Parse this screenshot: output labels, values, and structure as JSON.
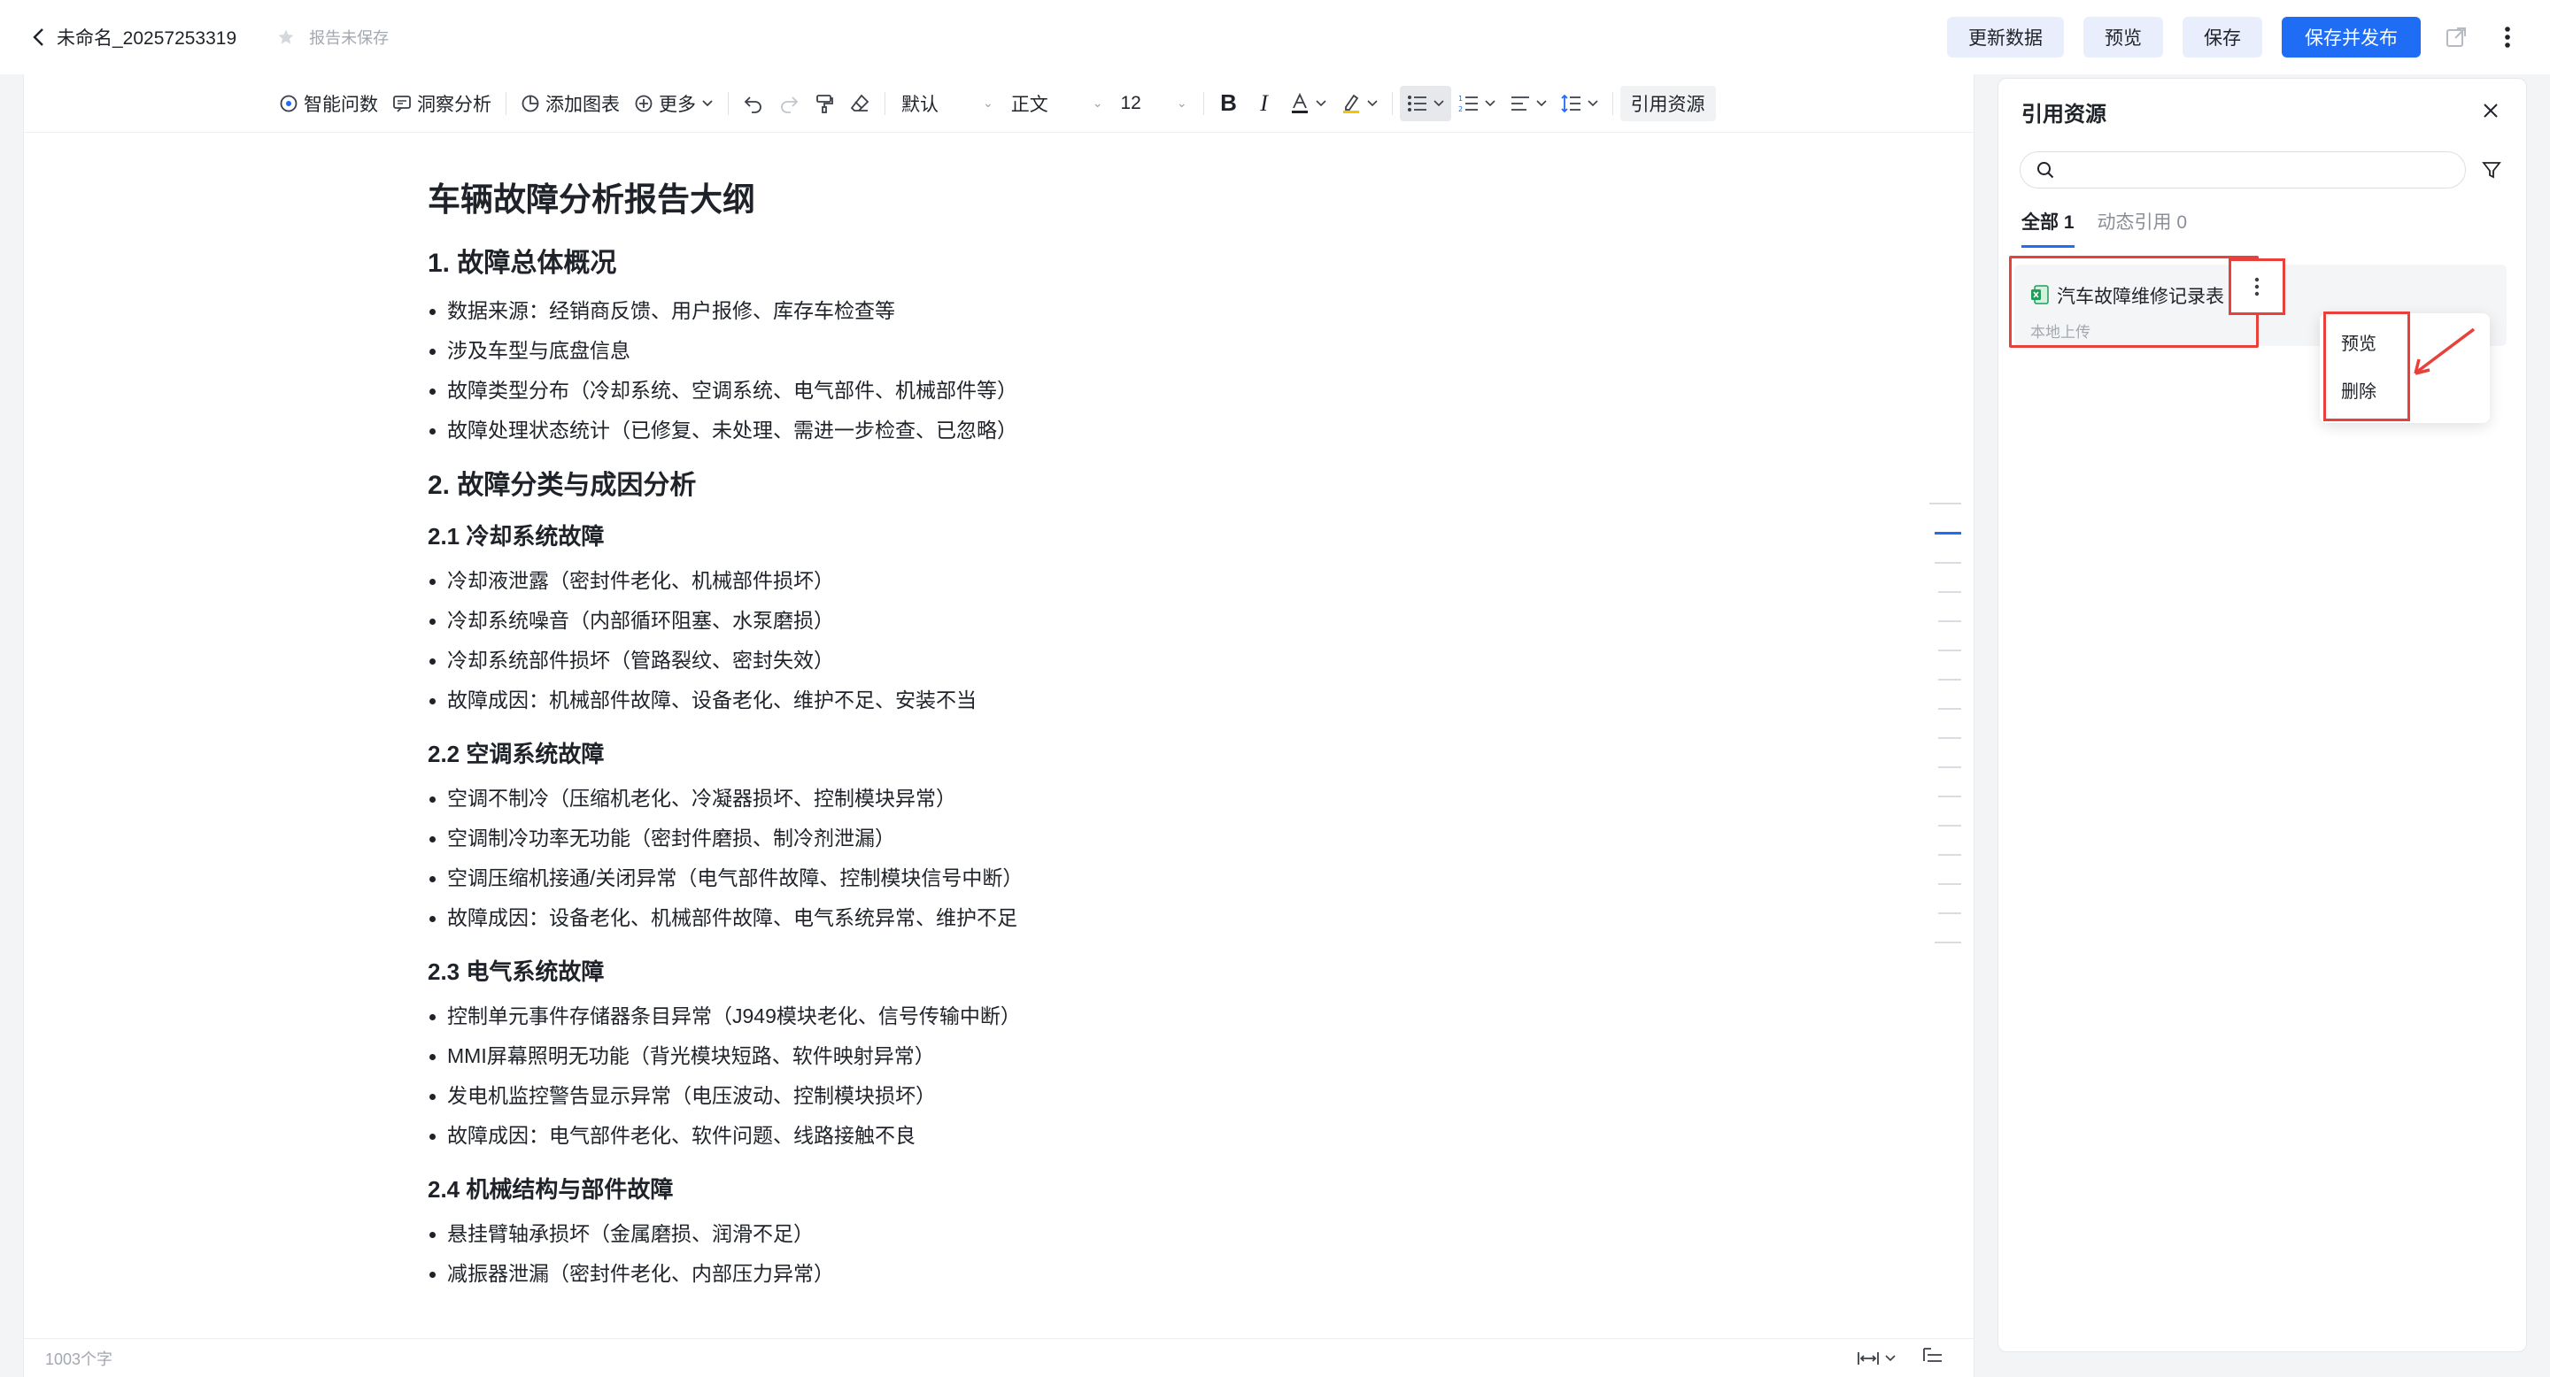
{
  "header": {
    "doc_title": "未命名_20257253319",
    "save_status": "报告未保存",
    "buttons": {
      "update": "更新数据",
      "preview": "预览",
      "save": "保存",
      "publish": "保存并发布"
    },
    "accent_color": "#1f6cf5"
  },
  "toolbar": {
    "ask": "智能问数",
    "insight": "洞察分析",
    "add_chart": "添加图表",
    "more": "更多",
    "font": "默认",
    "style": "正文",
    "size": "12",
    "cite": "引用资源"
  },
  "document": {
    "title": "车辆故障分析报告大纲",
    "s1": {
      "heading": "1. 故障总体概况",
      "items": [
        "数据来源：经销商反馈、用户报修、库存车检查等",
        "涉及车型与底盘信息",
        "故障类型分布（冷却系统、空调系统、电气部件、机械部件等）",
        "故障处理状态统计（已修复、未处理、需进一步检查、已忽略）"
      ]
    },
    "s2": {
      "heading": "2. 故障分类与成因分析"
    },
    "s21": {
      "heading": "2.1 冷却系统故障",
      "items": [
        "冷却液泄露（密封件老化、机械部件损坏）",
        "冷却系统噪音（内部循环阻塞、水泵磨损）",
        "冷却系统部件损坏（管路裂纹、密封失效）",
        "故障成因：机械部件故障、设备老化、维护不足、安装不当"
      ]
    },
    "s22": {
      "heading": "2.2 空调系统故障",
      "items": [
        "空调不制冷（压缩机老化、冷凝器损坏、控制模块异常）",
        "空调制冷功率无功能（密封件磨损、制冷剂泄漏）",
        "空调压缩机接通/关闭异常（电气部件故障、控制模块信号中断）",
        "故障成因：设备老化、机械部件故障、电气系统异常、维护不足"
      ]
    },
    "s23": {
      "heading": "2.3 电气系统故障",
      "items": [
        "控制单元事件存储器条目异常（J949模块老化、信号传输中断）",
        "MMI屏幕照明无功能（背光模块短路、软件映射异常）",
        "发电机监控警告显示异常（电压波动、控制模块损坏）",
        "故障成因：电气部件老化、软件问题、线路接触不良"
      ]
    },
    "s24": {
      "heading": "2.4 机械结构与部件故障",
      "items": [
        "悬挂臂轴承损坏（金属磨损、润滑不足）",
        "减振器泄漏（密封件老化、内部压力异常）"
      ]
    }
  },
  "footer": {
    "word_count": "1003个字"
  },
  "ref_panel": {
    "title": "引用资源",
    "search_placeholder": "",
    "tab_all": "全部 1",
    "tab_dynamic": "动态引用 0",
    "item": {
      "name": "汽车故障维修记录表",
      "source": "本地上传"
    },
    "menu": {
      "preview": "预览",
      "delete": "删除"
    },
    "highlight_color": "#e8413c"
  }
}
